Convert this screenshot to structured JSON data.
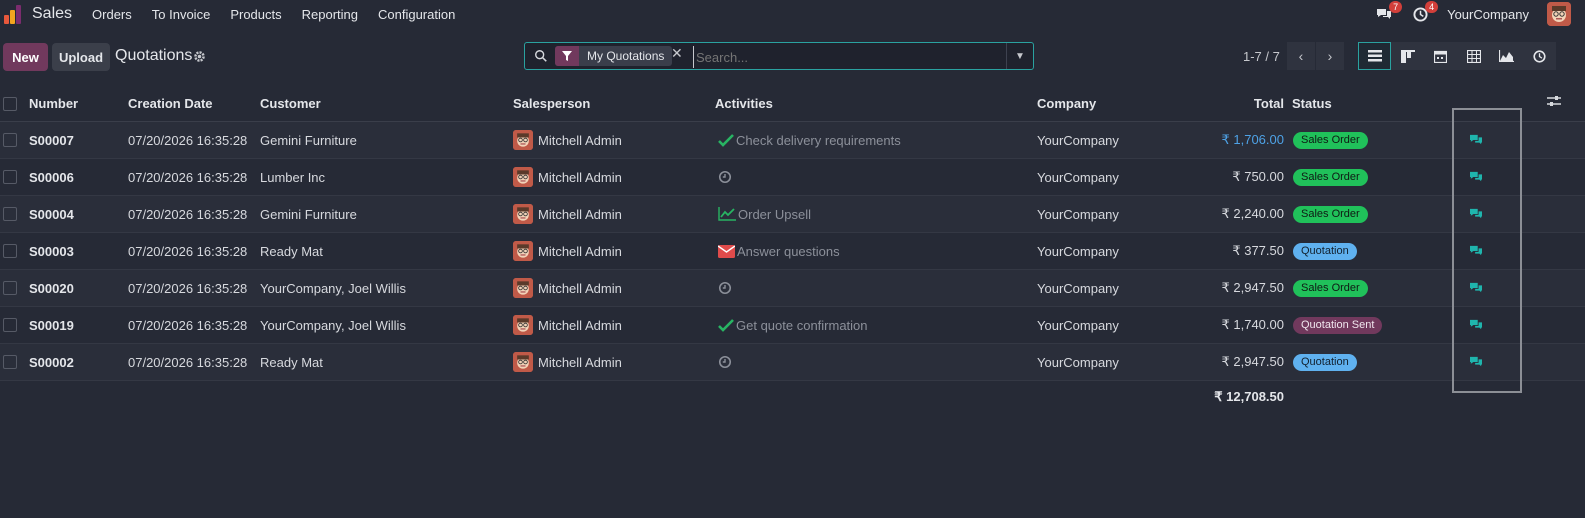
{
  "app": {
    "title": "Sales",
    "menu": [
      "Orders",
      "To Invoice",
      "Products",
      "Reporting",
      "Configuration"
    ],
    "messages_count": "7",
    "activities_count": "4",
    "company": "YourCompany"
  },
  "controls": {
    "new_label": "New",
    "upload_label": "Upload",
    "page_title": "Quotations",
    "facet_label": "My Quotations",
    "search_placeholder": "Search...",
    "pager": "1-7 / 7"
  },
  "columns": {
    "number": "Number",
    "creation_date": "Creation Date",
    "customer": "Customer",
    "salesperson": "Salesperson",
    "activities": "Activities",
    "company": "Company",
    "total": "Total",
    "status": "Status"
  },
  "rows": [
    {
      "number": "S00007",
      "date": "07/20/2026 16:35:28",
      "customer": "Gemini Furniture",
      "salesperson": "Mitchell Admin",
      "activity_icon": "check-icon",
      "activity": "Check delivery requirements",
      "company": "YourCompany",
      "total": "₹ 1,706.00",
      "total_highlight": true,
      "status": "Sales Order",
      "status_kind": "so"
    },
    {
      "number": "S00006",
      "date": "07/20/2026 16:35:28",
      "customer": "Lumber Inc",
      "salesperson": "Mitchell Admin",
      "activity_icon": "clock-icon",
      "activity": "",
      "company": "YourCompany",
      "total": "₹ 750.00",
      "total_highlight": false,
      "status": "Sales Order",
      "status_kind": "so"
    },
    {
      "number": "S00004",
      "date": "07/20/2026 16:35:28",
      "customer": "Gemini Furniture",
      "salesperson": "Mitchell Admin",
      "activity_icon": "trend-up-icon",
      "activity": "Order Upsell",
      "company": "YourCompany",
      "total": "₹ 2,240.00",
      "total_highlight": false,
      "status": "Sales Order",
      "status_kind": "so"
    },
    {
      "number": "S00003",
      "date": "07/20/2026 16:35:28",
      "customer": "Ready Mat",
      "salesperson": "Mitchell Admin",
      "activity_icon": "envelope-icon",
      "activity": "Answer questions",
      "company": "YourCompany",
      "total": "₹ 377.50",
      "total_highlight": false,
      "status": "Quotation",
      "status_kind": "q"
    },
    {
      "number": "S00020",
      "date": "07/20/2026 16:35:28",
      "customer": "YourCompany, Joel Willis",
      "salesperson": "Mitchell Admin",
      "activity_icon": "clock-icon",
      "activity": "",
      "company": "YourCompany",
      "total": "₹ 2,947.50",
      "total_highlight": false,
      "status": "Sales Order",
      "status_kind": "so"
    },
    {
      "number": "S00019",
      "date": "07/20/2026 16:35:28",
      "customer": "YourCompany, Joel Willis",
      "salesperson": "Mitchell Admin",
      "activity_icon": "check-icon",
      "activity": "Get quote confirmation",
      "company": "YourCompany",
      "total": "₹ 1,740.00",
      "total_highlight": false,
      "status": "Quotation Sent",
      "status_kind": "qs"
    },
    {
      "number": "S00002",
      "date": "07/20/2026 16:35:28",
      "customer": "Ready Mat",
      "salesperson": "Mitchell Admin",
      "activity_icon": "clock-icon",
      "activity": "",
      "company": "YourCompany",
      "total": "₹ 2,947.50",
      "total_highlight": false,
      "status": "Quotation",
      "status_kind": "q"
    }
  ],
  "sum_total": "₹ 12,708.50",
  "colors": {
    "accent": "#71395d",
    "teal": "#2aa2a0",
    "sales_order": "#20c15a",
    "quotation": "#5fb1ef",
    "quotation_sent": "#71395d",
    "activity_check": "#28b463",
    "activity_trend": "#28b463",
    "activity_envelope": "#e04b4b",
    "message_icon": "#1fb5ad"
  }
}
